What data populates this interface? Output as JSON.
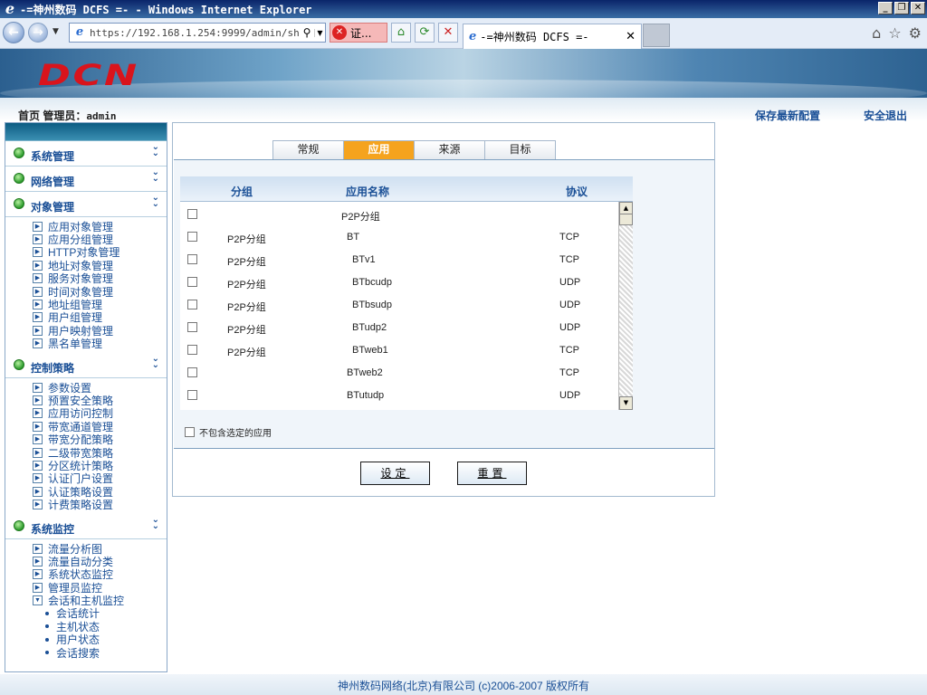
{
  "window": {
    "title": "-=神州数码 DCFS =- - Windows Internet Explorer",
    "buttons": [
      "_",
      "❐",
      "✕"
    ]
  },
  "browser": {
    "url": "https://192.168.1.254:9999/admin/show/",
    "cert_label": "证...",
    "tab_title": "-=神州数码 DCFS =-"
  },
  "header": {
    "logo": "DCN",
    "home_label": "首页 管理员：",
    "admin": "admin",
    "save_config": "保存最新配置",
    "logout": "安全退出"
  },
  "sidebar": {
    "sections": [
      {
        "label": "系统管理",
        "items": []
      },
      {
        "label": "网络管理",
        "items": []
      },
      {
        "label": "对象管理",
        "items": [
          "应用对象管理",
          "应用分组管理",
          "HTTP对象管理",
          "地址对象管理",
          "服务对象管理",
          "时间对象管理",
          "地址组管理",
          "用户组管理",
          "用户映射管理",
          "黑名单管理"
        ]
      },
      {
        "label": "控制策略",
        "items": [
          "参数设置",
          "预置安全策略",
          "应用访问控制",
          "带宽通道管理",
          "带宽分配策略",
          "二级带宽策略",
          "分区统计策略",
          "认证门户设置",
          "认证策略设置",
          "计费策略设置"
        ]
      },
      {
        "label": "系统监控",
        "items": [
          "流量分析图",
          "流量自动分类",
          "系统状态监控",
          "管理员监控",
          "会话和主机监控"
        ]
      }
    ],
    "subitems": [
      "会话统计",
      "主机状态",
      "用户状态",
      "会话搜索"
    ]
  },
  "tabs": [
    "常规",
    "应用",
    "来源",
    "目标"
  ],
  "active_tab": "应用",
  "table": {
    "headers": {
      "group": "分组",
      "name": "应用名称",
      "protocol": "协议"
    },
    "rows": [
      {
        "group": "",
        "name": "P2P分组",
        "protocol": ""
      },
      {
        "group": "P2P分组",
        "name": "BT",
        "protocol": "TCP"
      },
      {
        "group": "P2P分组",
        "name": "BTv1",
        "protocol": "TCP"
      },
      {
        "group": "P2P分组",
        "name": "BTbcudp",
        "protocol": "UDP"
      },
      {
        "group": "P2P分组",
        "name": "BTbsudp",
        "protocol": "UDP"
      },
      {
        "group": "P2P分组",
        "name": "BTudp2",
        "protocol": "UDP"
      },
      {
        "group": "P2P分组",
        "name": "BTweb1",
        "protocol": "TCP"
      },
      {
        "group": "",
        "name": "BTweb2",
        "protocol": "TCP"
      },
      {
        "group": "",
        "name": "BTutudp",
        "protocol": "UDP"
      }
    ]
  },
  "exclude_label": "不包含选定的应用",
  "buttons": {
    "set": "设定",
    "reset": "重置"
  },
  "footer": "神州数码网络(北京)有限公司 (c)2006-2007 版权所有",
  "colors": {
    "accent": "#f5a31e",
    "link": "#1a4f96",
    "brand": "#d9141c"
  }
}
